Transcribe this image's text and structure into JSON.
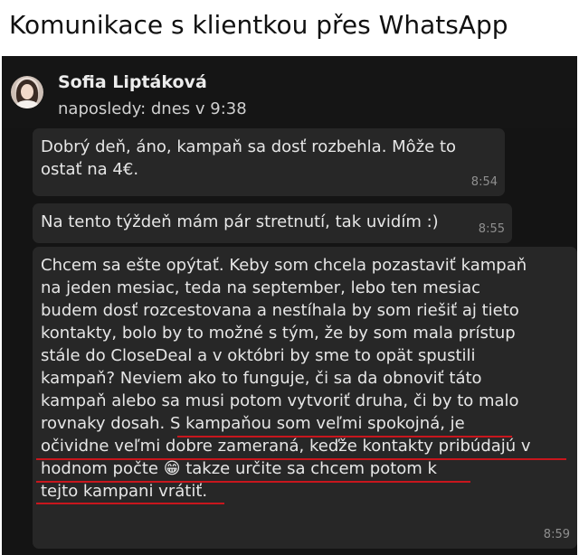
{
  "page": {
    "title": "Komunikace s klientkou přes WhatsApp"
  },
  "header": {
    "contact_name": "Sofia Liptáková",
    "status": "naposledy: dnes v 9:38"
  },
  "messages": [
    {
      "lines": [
        "Dobrý deň, áno, kampaň sa dosť rozbehla. Môže to",
        "ostať na 4€."
      ],
      "time": "8:54"
    },
    {
      "lines": [
        "Na tento týždeň mám pár stretnutí, tak uvidím :)"
      ],
      "time": "8:55"
    },
    {
      "lines": [
        "Chcem sa ešte opýtať. Keby som chcela pozastaviť kampaň",
        "na jeden mesiac, teda na september, lebo ten mesiac",
        "budem dosť rozcestovana a nestíhala by som riešiť aj tieto",
        "kontakty, bolo by to možné s tým, že by som mala prístup",
        "stále do CloseDeal a v októbri by sme to opät spustili",
        "kampaň? Neviem ako to funguje, či sa da obnoviť táto",
        "kampaň alebo sa musi potom vytvoriť druha, či by to malo",
        "rovnaky dosah. S kampaňou som veľmi spokojná, je",
        "očividne veľmi dobre zameraná, keďže kontakty pribúdajú v",
        "hodnom počte 😁 takze určite sa chcem potom k",
        "tejto kampani vrátiť."
      ],
      "time": "8:59"
    }
  ],
  "colors": {
    "chat_background": "#141414",
    "bubble_background": "#272727",
    "underline_highlight": "#c8161d"
  }
}
